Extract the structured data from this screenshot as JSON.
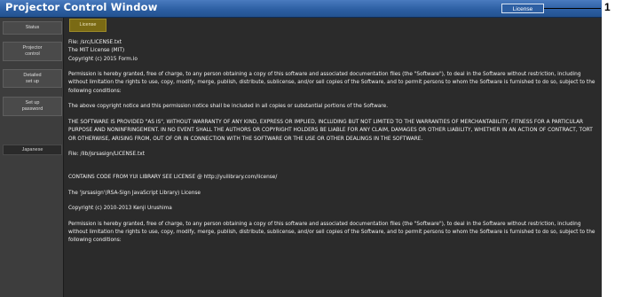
{
  "window": {
    "title": "Projector Control Window",
    "license_button": "License"
  },
  "sidebar": {
    "items": [
      {
        "label": "Status"
      },
      {
        "label": "Projector\ncontrol"
      },
      {
        "label": "Detailed\nset up"
      },
      {
        "label": "Set up\npassword"
      },
      {
        "label": "Japanese"
      }
    ]
  },
  "content": {
    "active_tab": "License",
    "paragraphs": [
      "File: /src/LICENSE.txt\nThe MIT License (MIT)\nCopyright (c) 2015 Form.io",
      "Permission is hereby granted, free of charge, to any person obtaining a copy of this software and associated documentation files (the \"Software\"), to deal in the Software without restriction, including without limitation the rights to use, copy, modify, merge, publish, distribute, sublicense, and/or sell copies of the Software, and to permit persons to whom the Software is furnished to do so, subject to the following conditions:",
      "The above copyright notice and this permission notice shall be included in all copies or substantial portions of the Software.",
      "THE SOFTWARE IS PROVIDED \"AS IS\", WITHOUT WARRANTY OF ANY KIND, EXPRESS OR IMPLIED, INCLUDING BUT NOT LIMITED TO THE WARRANTIES OF MERCHANTABILITY, FITNESS FOR A PARTICULAR PURPOSE AND NONINFRINGEMENT. IN NO EVENT SHALL THE AUTHORS OR COPYRIGHT HOLDERS BE LIABLE FOR ANY CLAIM, DAMAGES OR OTHER LIABILITY, WHETHER IN AN ACTION OF CONTRACT, TORT OR OTHERWISE, ARISING FROM, OUT OF OR IN CONNECTION WITH THE SOFTWARE OR THE USE OR OTHER DEALINGS IN THE SOFTWARE.",
      "File: /lib/jsrsasign/LICENSE.txt",
      "CONTAINS CODE FROM YUI LIBRARY SEE LICENSE @ http://yuilibrary.com/license/",
      "The 'jsrsasign'(RSA-Sign JavaScript Library) License",
      "Copyright (c) 2010-2013 Kenji Urushima",
      "Permission is hereby granted, free of charge, to any person obtaining a copy of this software and associated documentation files (the \"Software\"), to deal in the Software without restriction, including without limitation the rights to use, copy, modify, merge, publish, distribute, sublicense, and/or sell copies of the Software, and to permit persons to whom the Software is furnished to do so, subject to the following conditions:"
    ]
  },
  "callout": {
    "number": "1"
  },
  "colors": {
    "titlebar": "#2d5fa3",
    "sidebar": "#3d3d3d",
    "content_bg": "#2b2b2b",
    "active_tab": "#7a6a14",
    "text": "#f2f2f2"
  }
}
